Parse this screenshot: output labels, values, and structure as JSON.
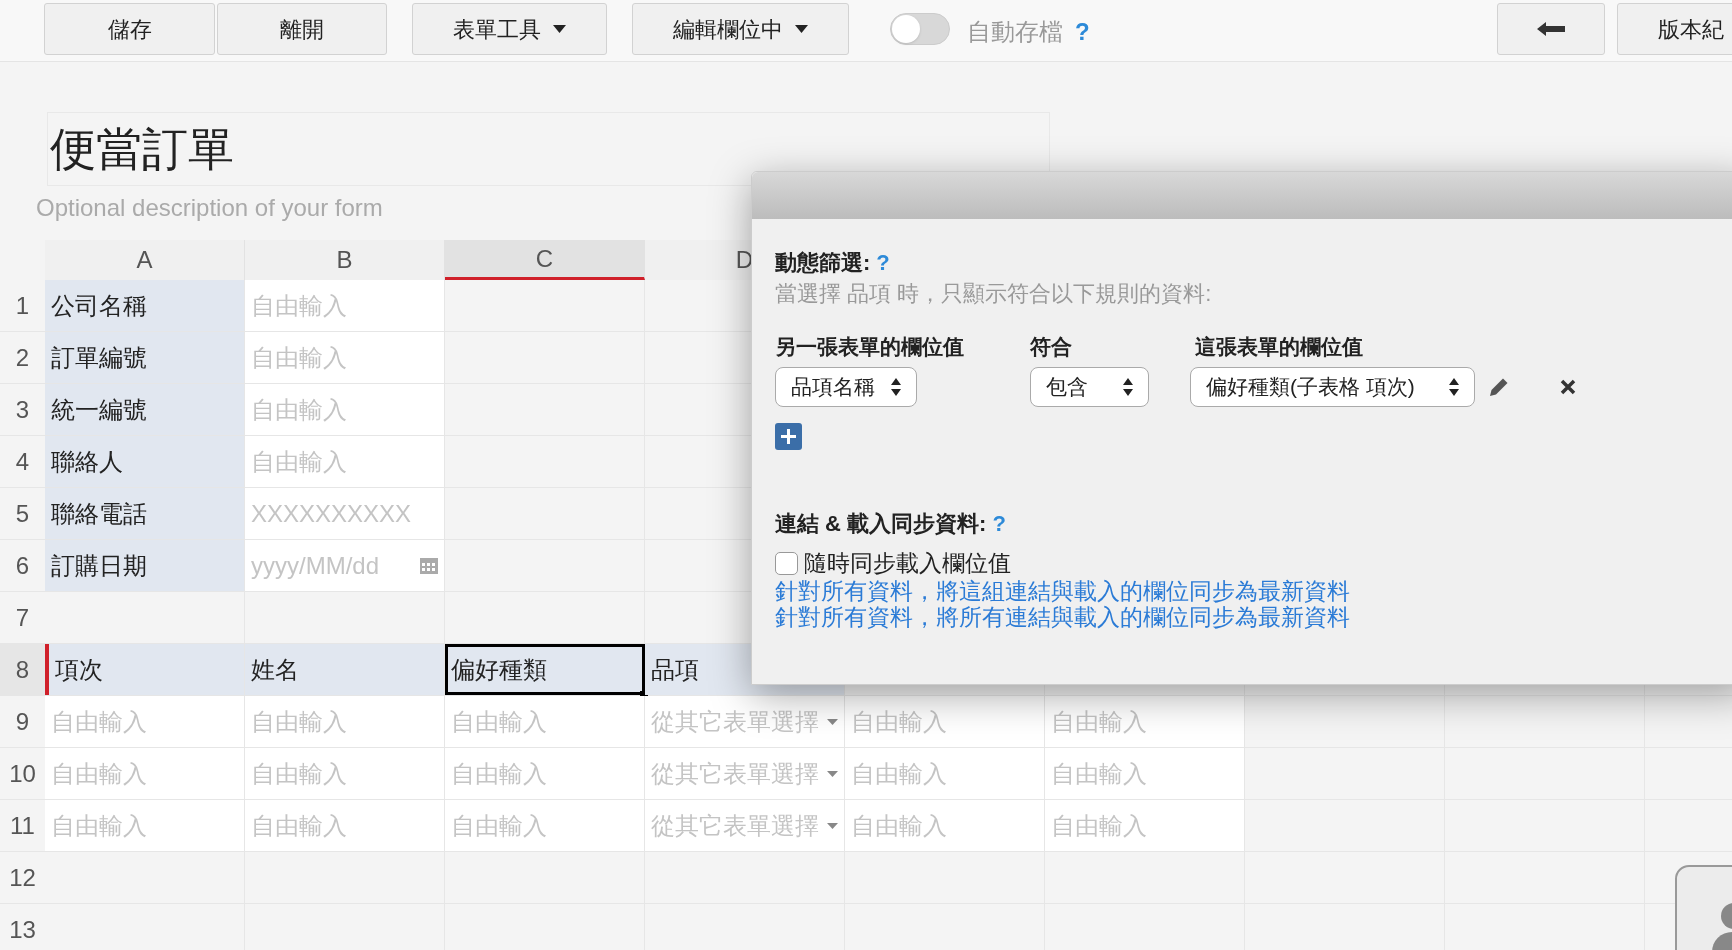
{
  "toolbar": {
    "buttons": [
      {
        "label": "儲存",
        "kind": "plain"
      },
      {
        "label": "離開",
        "kind": "plain"
      },
      {
        "label": "表單工具",
        "kind": "dropdown"
      },
      {
        "label": "編輯欄位中",
        "kind": "dropdown"
      }
    ],
    "autosave": {
      "label": "自動存檔",
      "help": "?",
      "on": false
    },
    "version_button": {
      "label": "版本紀"
    }
  },
  "form": {
    "title": "便當訂單",
    "description_placeholder": "Optional description of your form"
  },
  "sheet": {
    "columns": [
      {
        "letter": "A",
        "selected": false
      },
      {
        "letter": "B",
        "selected": false
      },
      {
        "letter": "C",
        "selected": true
      },
      {
        "letter": "D",
        "selected": false
      }
    ],
    "rows": [
      {
        "number": "1",
        "selected": false,
        "cells": [
          {
            "kind": "label",
            "text": "公司名稱"
          },
          {
            "kind": "placeholder",
            "text": "自由輸入"
          }
        ]
      },
      {
        "number": "2",
        "selected": false,
        "cells": [
          {
            "kind": "label",
            "text": "訂單編號"
          },
          {
            "kind": "placeholder",
            "text": "自由輸入"
          }
        ]
      },
      {
        "number": "3",
        "selected": false,
        "cells": [
          {
            "kind": "label",
            "text": "統一編號"
          },
          {
            "kind": "placeholder",
            "text": "自由輸入"
          }
        ]
      },
      {
        "number": "4",
        "selected": false,
        "cells": [
          {
            "kind": "label",
            "text": "聯絡人"
          },
          {
            "kind": "placeholder",
            "text": "自由輸入"
          }
        ]
      },
      {
        "number": "5",
        "selected": false,
        "cells": [
          {
            "kind": "label",
            "text": "聯絡電話"
          },
          {
            "kind": "placeholder",
            "text": "XXXXXXXXXX"
          }
        ]
      },
      {
        "number": "6",
        "selected": false,
        "cells": [
          {
            "kind": "label",
            "text": "訂購日期"
          },
          {
            "kind": "date",
            "text": "yyyy/MM/dd"
          }
        ]
      },
      {
        "number": "7",
        "selected": false,
        "cells": []
      },
      {
        "number": "8",
        "selected": true,
        "cells": [
          {
            "kind": "header",
            "text": "項次",
            "selected": false
          },
          {
            "kind": "header",
            "text": "姓名",
            "selected": false
          },
          {
            "kind": "header",
            "text": "偏好種類",
            "selected": true
          },
          {
            "kind": "header",
            "text": "品項",
            "selected": false
          }
        ]
      },
      {
        "number": "9",
        "selected": false,
        "cells": [
          {
            "kind": "placeholder",
            "text": "自由輸入"
          },
          {
            "kind": "placeholder",
            "text": "自由輸入"
          },
          {
            "kind": "placeholder",
            "text": "自由輸入"
          },
          {
            "kind": "picker",
            "text": "從其它表單選擇"
          },
          {
            "kind": "placeholder",
            "text": "自由輸入"
          },
          {
            "kind": "placeholder",
            "text": "自由輸入"
          }
        ]
      },
      {
        "number": "10",
        "selected": false,
        "cells": [
          {
            "kind": "placeholder",
            "text": "自由輸入"
          },
          {
            "kind": "placeholder",
            "text": "自由輸入"
          },
          {
            "kind": "placeholder",
            "text": "自由輸入"
          },
          {
            "kind": "picker",
            "text": "從其它表單選擇"
          },
          {
            "kind": "placeholder",
            "text": "自由輸入"
          },
          {
            "kind": "placeholder",
            "text": "自由輸入"
          }
        ]
      },
      {
        "number": "11",
        "selected": false,
        "cells": [
          {
            "kind": "placeholder",
            "text": "自由輸入"
          },
          {
            "kind": "placeholder",
            "text": "自由輸入"
          },
          {
            "kind": "placeholder",
            "text": "自由輸入"
          },
          {
            "kind": "picker",
            "text": "從其它表單選擇"
          },
          {
            "kind": "placeholder",
            "text": "自由輸入"
          },
          {
            "kind": "placeholder",
            "text": "自由輸入"
          }
        ]
      },
      {
        "number": "12",
        "selected": false,
        "cells": []
      },
      {
        "number": "13",
        "selected": false,
        "cells": []
      }
    ]
  },
  "dialog": {
    "filter": {
      "title": "動態篩選:",
      "help": "?",
      "description": "當選擇 品項 時，只顯示符合以下規則的資料:",
      "headers": [
        "另一張表單的欄位值",
        "符合",
        "這張表單的欄位值"
      ],
      "rules": [
        {
          "other_field": "品項名稱",
          "operator": "包含",
          "this_field": "偏好種類(子表格 項次)"
        }
      ]
    },
    "sync": {
      "title": "連結 & 載入同步資料:",
      "help": "?",
      "checkbox": {
        "label": "隨時同步載入欄位值",
        "checked": false
      },
      "links": [
        "針對所有資料，將這組連結與載入的欄位同步為最新資料",
        "針對所有資料，將所有連結與載入的欄位同步為最新資料"
      ]
    }
  }
}
